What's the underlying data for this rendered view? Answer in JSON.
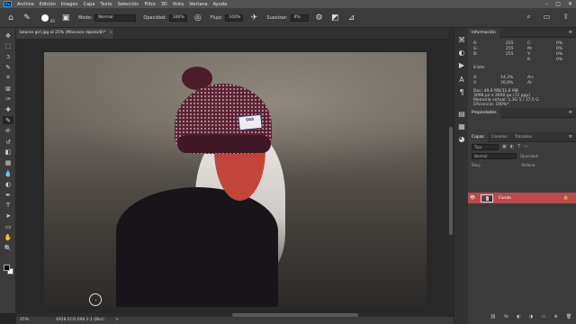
{
  "app": {
    "logo": "Ps"
  },
  "menu": [
    "Archivo",
    "Edición",
    "Imagen",
    "Capa",
    "Texto",
    "Selección",
    "Filtro",
    "3D",
    "Vista",
    "Ventana",
    "Ayuda"
  ],
  "window_controls": [
    "–",
    "▢",
    "✕"
  ],
  "options": {
    "brush_size": "65",
    "mode_label": "Modo:",
    "mode_value": "Normal",
    "opacity_label": "Opacidad:",
    "opacity_value": "100%",
    "flow_label": "Flujo:",
    "flow_value": "100%",
    "smoothing_label": "Suavizar:",
    "smoothing_value": "0%"
  },
  "document_tab": {
    "title": "beanie girl.jpg al 25% (Máscara rápida/8)",
    "modified": "*",
    "close": "×"
  },
  "tools": [
    "move-tool",
    "marquee-tool",
    "lasso-tool",
    "quick-select-tool",
    "crop-tool",
    "frame-tool",
    "eyedropper-tool",
    "healing-tool",
    "brush-tool",
    "clone-stamp-tool",
    "history-brush-tool",
    "eraser-tool",
    "gradient-tool",
    "blur-tool",
    "dodge-tool",
    "pen-tool",
    "type-tool",
    "path-select-tool",
    "rectangle-tool",
    "hand-tool",
    "zoom-tool"
  ],
  "tool_glyphs": [
    "✥",
    "⬚",
    "ↄ",
    "✎",
    "⌗",
    "⊠",
    "✑",
    "✚",
    "✎",
    "⎆",
    "↺",
    "◧",
    "▦",
    "💧",
    "◐",
    "✒",
    "T",
    "➤",
    "▭",
    "✋",
    "🔍"
  ],
  "beanie_text": "SGS",
  "status": {
    "zoom": "25%",
    "doc": "4928 ECO.098 3.1 (Bks)",
    "arrow": ">"
  },
  "info_panel": {
    "tab": "Información",
    "r": "R:",
    "r_val": "255",
    "g": "G:",
    "g_val": "255",
    "b": "B:",
    "b_val": "255",
    "c": "C:",
    "c_val": "0%",
    "m": "M:",
    "m_val": "0%",
    "y": "Y:",
    "y_val": "0%",
    "k": "K:",
    "k_val": "0%",
    "bits": "8 bits",
    "x": "X:",
    "x_val": "14,3%",
    "yy": "Y:",
    "yy_val": "76,9%",
    "w": "An:",
    "h": "Al:",
    "doc_size": "Doc: 49,6 MB/31,6 MB",
    "pixel_info": "3096 px x 3600 px (72 ppp)",
    "scratch": "Memoria virtual: 1,3G 5 / 17,5 G",
    "efficiency": "Eficiencia: 100%*"
  },
  "properties_panel": {
    "tab": "Propiedades"
  },
  "layers_panel": {
    "tabs": [
      "Capas",
      "Canales",
      "Trazados"
    ],
    "filter_placeholder": "Tipo",
    "blend_mode": "Normal",
    "opacity_label": "Opacidad:",
    "lock_label": "Bloq.:",
    "fill_label": "Relleno:",
    "layer_name": "Fondo"
  },
  "footer_icons": [
    "⛓",
    "fx",
    "◐",
    "◑",
    "▭",
    "⊕",
    "🗑"
  ]
}
